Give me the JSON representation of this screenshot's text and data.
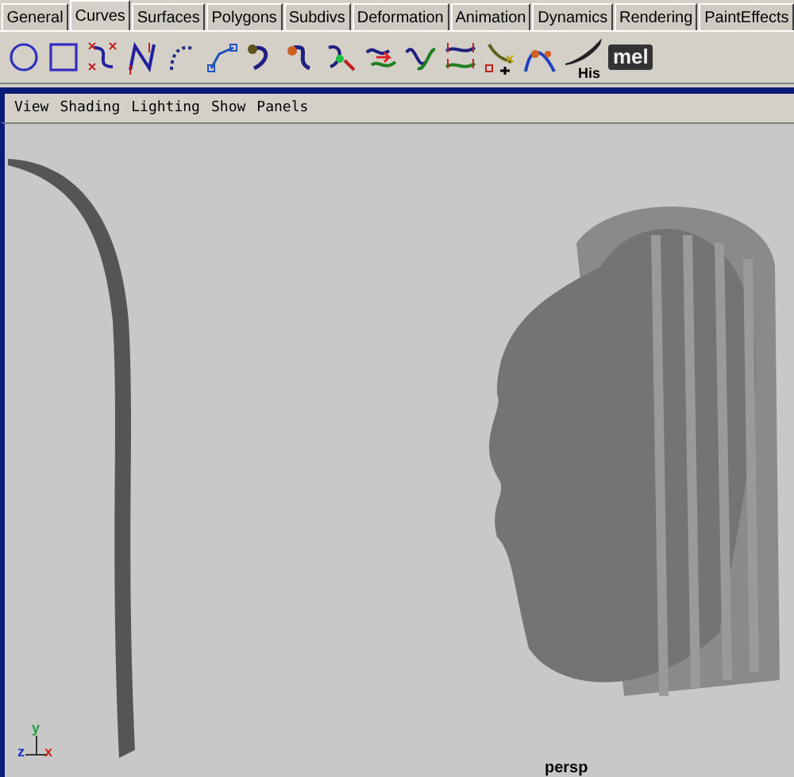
{
  "tabs": [
    {
      "label": "General",
      "selected": false
    },
    {
      "label": "Curves",
      "selected": true
    },
    {
      "label": "Surfaces",
      "selected": false
    },
    {
      "label": "Polygons",
      "selected": false
    },
    {
      "label": "Subdivs",
      "selected": false
    },
    {
      "label": "Deformation",
      "selected": false
    },
    {
      "label": "Animation",
      "selected": false
    },
    {
      "label": "Dynamics",
      "selected": false
    },
    {
      "label": "Rendering",
      "selected": false
    },
    {
      "label": "PaintEffects",
      "selected": false
    }
  ],
  "shelf": {
    "history_label": "His",
    "mel_label": "mel"
  },
  "panel_menu": [
    "View",
    "Shading",
    "Lighting",
    "Show",
    "Panels"
  ],
  "viewport": {
    "axis": {
      "y": "y",
      "z": "z",
      "x": "x"
    },
    "camera_label": "persp"
  }
}
